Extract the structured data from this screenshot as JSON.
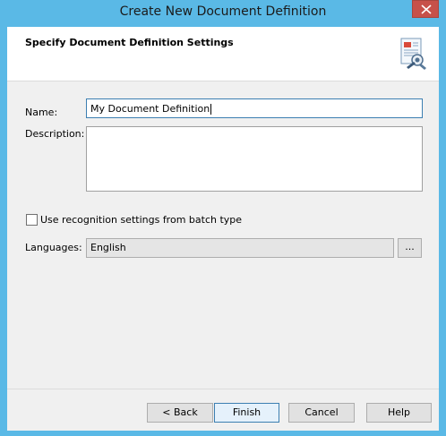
{
  "window": {
    "title": "Create New Document Definition"
  },
  "header": {
    "title": "Specify Document Definition Settings",
    "icon": "document-settings-icon"
  },
  "form": {
    "name_label": "Name:",
    "name_value": "My Document Definition",
    "description_label": "Description:",
    "description_value": "",
    "use_recognition_label": "Use recognition settings from batch type",
    "use_recognition_checked": false,
    "languages_label": "Languages:",
    "languages_value": "English",
    "browse_label": "..."
  },
  "buttons": {
    "back": "< Back",
    "finish": "Finish",
    "cancel": "Cancel",
    "help": "Help"
  },
  "colors": {
    "titlebar": "#5ab9e6",
    "close": "#c7514a",
    "focus_border": "#3c7fb1"
  }
}
